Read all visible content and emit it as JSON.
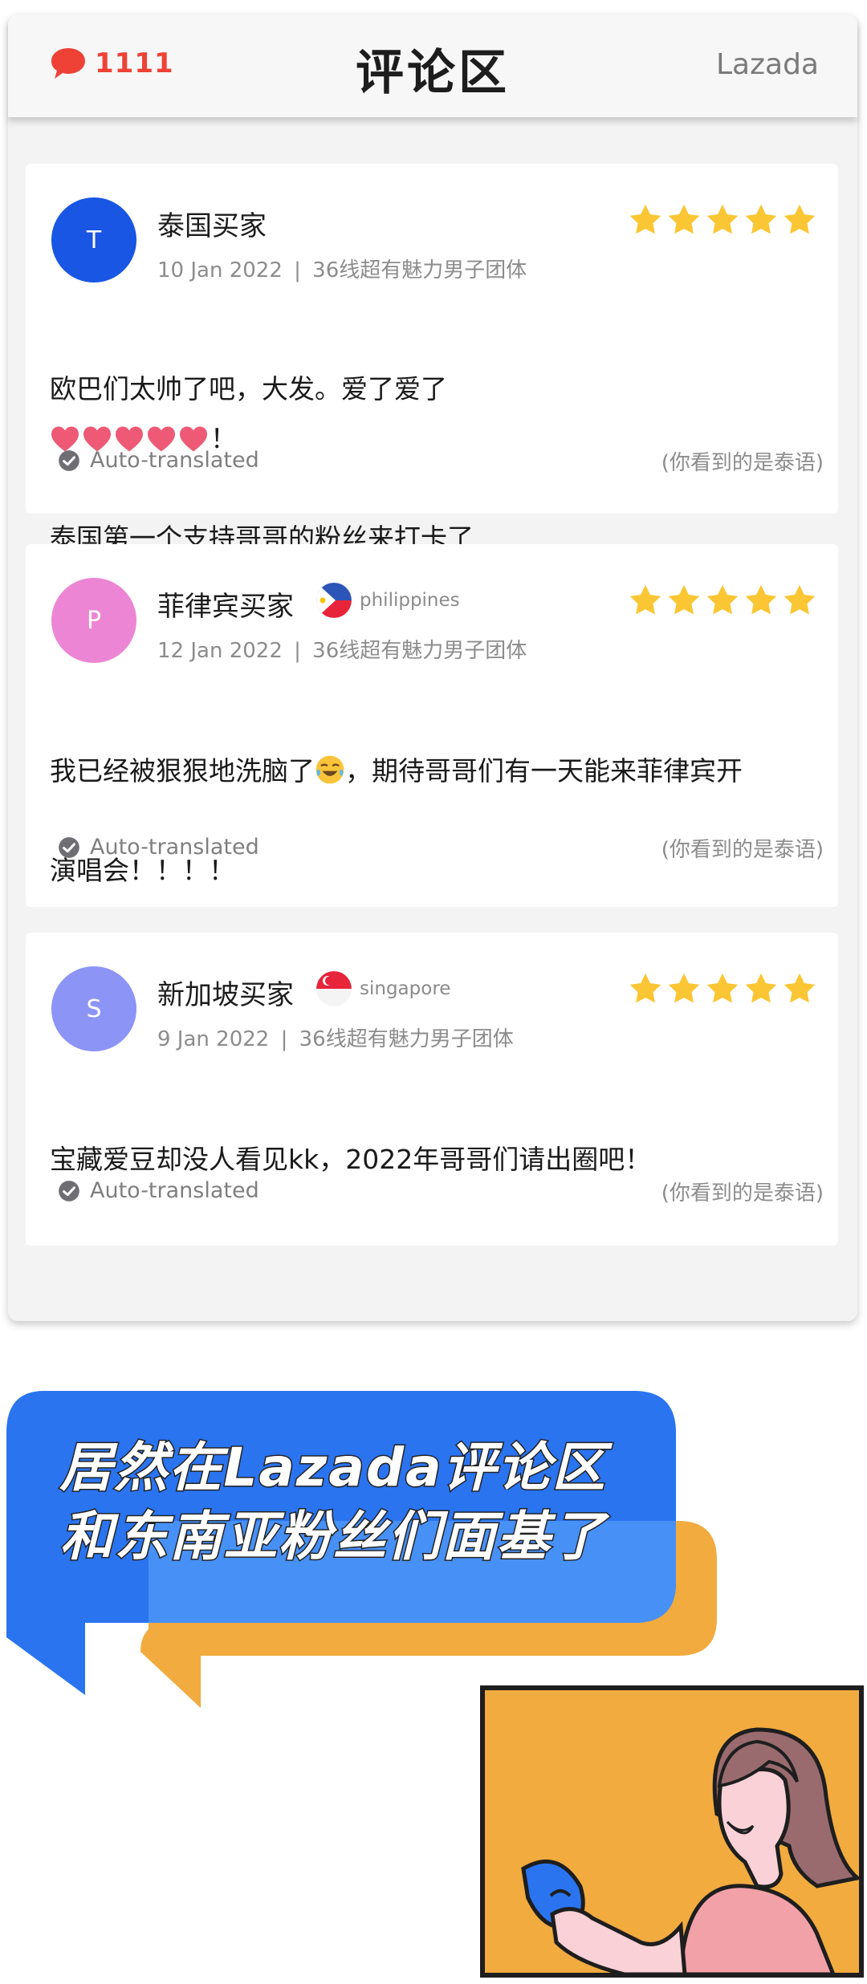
{
  "header": {
    "comment_count": "1111",
    "title": "评论区",
    "brand": "Lazada",
    "bubble_color": "#ee4236"
  },
  "reviews": [
    {
      "avatar_letter": "T",
      "avatar_color": "#1856e3",
      "name": "泰国买家",
      "country": "",
      "date": "10 Jan 2022",
      "product": "36线超有魅力男子团体",
      "rating": 5,
      "text_line1": "欧巴们太帅了吧，大发。爱了爱了",
      "text_line1_end": "！",
      "text_line2": "泰国第一个支持哥哥的粉丝来打卡了",
      "auto_translated": "Auto-translated",
      "language_note": "(你看到的是泰语)"
    },
    {
      "avatar_letter": "P",
      "avatar_color": "#ec86d4",
      "name": "菲律宾买家",
      "country": "philippines",
      "date": "12 Jan 2022",
      "product": "36线超有魅力男子团体",
      "rating": 5,
      "text_line1": "我已经被狠狠地洗脑了",
      "text_line1_end": "，期待哥哥们有一天能来菲律宾开",
      "text_line2": "演唱会！！！！",
      "auto_translated": "Auto-translated",
      "language_note": "(你看到的是泰语)"
    },
    {
      "avatar_letter": "S",
      "avatar_color": "#8c94f5",
      "name": "新加坡买家",
      "country": "singapore",
      "date": "9 Jan 2022",
      "product": "36线超有魅力男子团体",
      "rating": 5,
      "text_line1": "宝藏爱豆却没人看见kk，2022年哥哥们请出圈吧！",
      "auto_translated": "Auto-translated",
      "language_note": "(你看到的是泰语)"
    }
  ],
  "promo": {
    "line1": "居然在Lazada评论区",
    "line2": "和东南亚粉丝们面基了",
    "blue": "#2a74f0",
    "orange": "#f2ab3f"
  }
}
